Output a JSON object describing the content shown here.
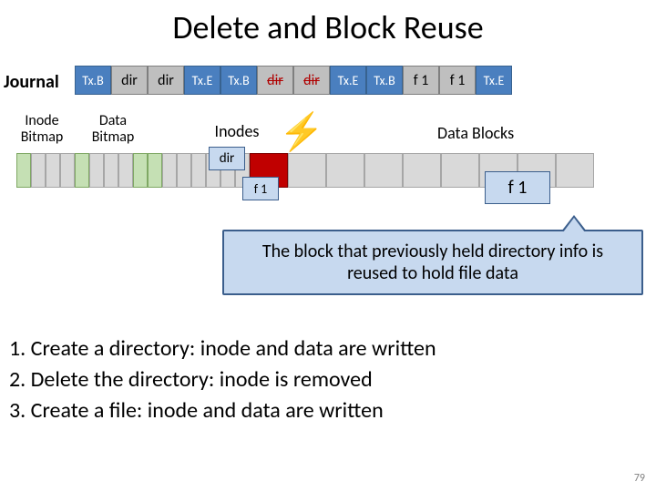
{
  "title": "Delete and Block Reuse",
  "journal_label": "Journal",
  "labels": {
    "inode_bm": "Inode Bitmap",
    "data_bm": "Data Bitmap",
    "inodes": "Inodes",
    "data_blocks": "Data Blocks"
  },
  "journal": {
    "c0": "Tx.B",
    "c1": "dir",
    "c2": "dir",
    "c3": "Tx.E",
    "c4": "Tx.B",
    "c5": "dir",
    "c6": "dir",
    "c7": "Tx.E",
    "c8": "Tx.B",
    "c9": "f 1",
    "c10": "f 1",
    "c11": "Tx.E"
  },
  "overlays": {
    "dir": "dir",
    "f1_left": "f 1",
    "f1_right": "f 1"
  },
  "callout": "The block that previously held directory info is reused to hold file data",
  "steps": {
    "s1": "1.  Create a directory: inode and data are written",
    "s2": "2.  Delete the directory: inode is removed",
    "s3": "3.  Create a file: inode and data are written"
  },
  "pagenum": "79",
  "bolt_glyph": "⚡"
}
